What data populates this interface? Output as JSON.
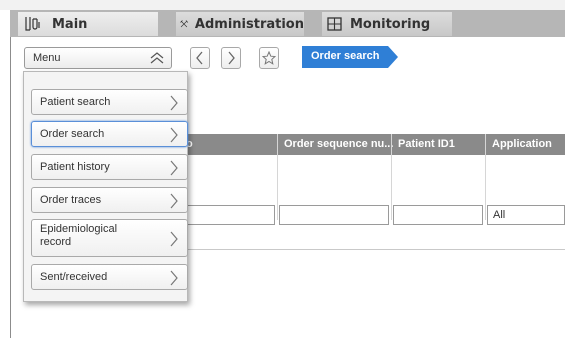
{
  "tabs": [
    {
      "label": "Main",
      "icon": "flask-icon"
    },
    {
      "label": "Administration",
      "icon": "tools-icon"
    },
    {
      "label": "Monitoring",
      "icon": "monitor-icon"
    }
  ],
  "toolbar": {
    "menu_label": "Menu",
    "breadcrumb": "Order search",
    "accent": "#2f7fd6"
  },
  "grid": {
    "columns": [
      "Order sequence nu...",
      "Patient ID1",
      "Application"
    ],
    "partial_column_char": "o",
    "application_filter": "All"
  },
  "menu": {
    "items": [
      {
        "label": "Patient search"
      },
      {
        "label": "Order search",
        "active": true
      },
      {
        "label": "Patient history"
      },
      {
        "label": "Order traces"
      },
      {
        "label": "Epidemiological record"
      },
      {
        "label": "Sent/received"
      }
    ]
  }
}
